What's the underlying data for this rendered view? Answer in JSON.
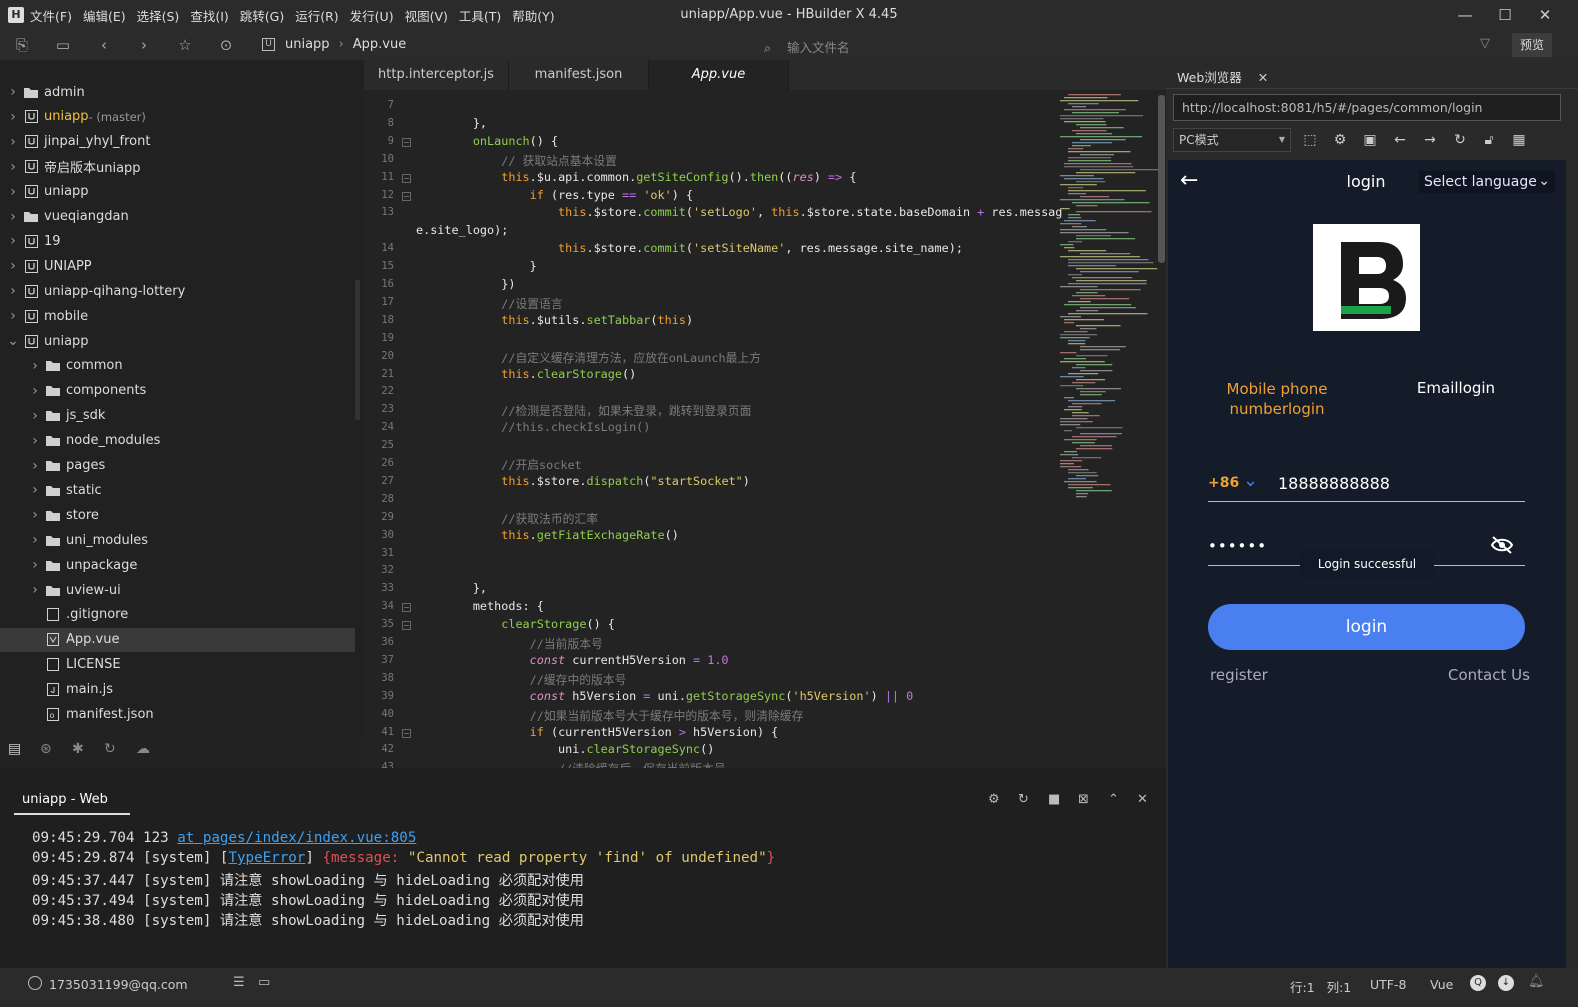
{
  "titlebar": {
    "title": "uniapp/App.vue - HBuilder X 4.45",
    "menu": [
      "文件(F)",
      "编辑(E)",
      "选择(S)",
      "查找(I)",
      "跳转(G)",
      "运行(R)",
      "发行(U)",
      "视图(V)",
      "工具(T)",
      "帮助(Y)"
    ]
  },
  "toolbar": {
    "breadcrumb": [
      "uniapp",
      "App.vue"
    ],
    "search_placeholder": "输入文件名",
    "preview_label": "预览"
  },
  "sidebar": {
    "items": [
      {
        "label": "admin",
        "suffix": "",
        "type": "folder",
        "level": 0,
        "open": false
      },
      {
        "label": "uniapp",
        "suffix": " - (master)",
        "type": "project",
        "level": 0,
        "open": false,
        "accent": true
      },
      {
        "label": "jinpai_yhyl_front",
        "suffix": "",
        "type": "project",
        "level": 0,
        "open": false
      },
      {
        "label": "帝启版本uniapp",
        "suffix": "",
        "type": "project",
        "level": 0,
        "open": false
      },
      {
        "label": "uniapp",
        "suffix": "",
        "type": "project",
        "level": 0,
        "open": false
      },
      {
        "label": "vueqiangdan",
        "suffix": "",
        "type": "folder",
        "level": 0,
        "open": false
      },
      {
        "label": "19",
        "suffix": "",
        "type": "project",
        "level": 0,
        "open": false
      },
      {
        "label": "UNIAPP",
        "suffix": "",
        "type": "project",
        "level": 0,
        "open": false
      },
      {
        "label": "uniapp-qihang-lottery",
        "suffix": "",
        "type": "project",
        "level": 0,
        "open": false
      },
      {
        "label": "mobile",
        "suffix": "",
        "type": "project",
        "level": 0,
        "open": false
      },
      {
        "label": "uniapp",
        "suffix": "",
        "type": "project",
        "level": 0,
        "open": true
      },
      {
        "label": "common",
        "suffix": "",
        "type": "folder",
        "level": 1,
        "open": false
      },
      {
        "label": "components",
        "suffix": "",
        "type": "folder",
        "level": 1,
        "open": false
      },
      {
        "label": "js_sdk",
        "suffix": "",
        "type": "folder",
        "level": 1,
        "open": false
      },
      {
        "label": "node_modules",
        "suffix": "",
        "type": "folder",
        "level": 1,
        "open": false
      },
      {
        "label": "pages",
        "suffix": "",
        "type": "folder",
        "level": 1,
        "open": false
      },
      {
        "label": "static",
        "suffix": "",
        "type": "folder",
        "level": 1,
        "open": false
      },
      {
        "label": "store",
        "suffix": "",
        "type": "folder",
        "level": 1,
        "open": false
      },
      {
        "label": "uni_modules",
        "suffix": "",
        "type": "folder",
        "level": 1,
        "open": false
      },
      {
        "label": "unpackage",
        "suffix": "",
        "type": "folder",
        "level": 1,
        "open": false
      },
      {
        "label": "uview-ui",
        "suffix": "",
        "type": "folder",
        "level": 1,
        "open": false
      },
      {
        "label": ".gitignore",
        "suffix": "",
        "type": "file",
        "level": 1
      },
      {
        "label": "App.vue",
        "suffix": "",
        "type": "vue",
        "level": 1,
        "selected": true
      },
      {
        "label": "LICENSE",
        "suffix": "",
        "type": "file",
        "level": 1
      },
      {
        "label": "main.js",
        "suffix": "",
        "type": "js",
        "level": 1
      },
      {
        "label": "manifest.json",
        "suffix": "",
        "type": "json",
        "level": 1
      }
    ]
  },
  "tabs": [
    "http.interceptor.js",
    "manifest.json",
    "App.vue"
  ],
  "editor": {
    "lines": [
      {
        "n": "7",
        "fold": false,
        "html": ""
      },
      {
        "n": "8",
        "fold": false,
        "html": "        },"
      },
      {
        "n": "9",
        "fold": true,
        "html": "        <span class='fn'>onLaunch</span>() {"
      },
      {
        "n": "10",
        "fold": false,
        "html": "            <span class='cm'>// 获取站点基本设置</span>"
      },
      {
        "n": "11",
        "fold": true,
        "html": "            <span class='kw'>this</span>.$u.api.common.<span class='fn'>getSiteConfig</span>().<span class='fn'>then</span>((<span class='it'>res</span>) <span class='op'>=></span> {"
      },
      {
        "n": "12",
        "fold": true,
        "html": "                <span class='kw'>if</span> (res.type <span class='op'>==</span> <span class='str'>'ok'</span>) {"
      },
      {
        "n": "13",
        "fold": false,
        "html": "                    <span class='kw'>this</span>.$store.<span class='fn'>commit</span>(<span class='str'>'setLogo'</span>, <span class='kw'>this</span>.$store.state.baseDomain <span class='op'>+</span> res.messag"
      },
      {
        "n": "",
        "fold": false,
        "html": "e.site_logo);",
        "wrap": true
      },
      {
        "n": "14",
        "fold": false,
        "html": "                    <span class='kw'>this</span>.$store.<span class='fn'>commit</span>(<span class='str'>'setSiteName'</span>, res.message.site_name);"
      },
      {
        "n": "15",
        "fold": false,
        "html": "                }"
      },
      {
        "n": "16",
        "fold": false,
        "html": "            })"
      },
      {
        "n": "17",
        "fold": false,
        "html": "            <span class='cm'>//设置语言</span>"
      },
      {
        "n": "18",
        "fold": false,
        "html": "            <span class='kw'>this</span>.$utils.<span class='fn'>setTabbar</span>(<span class='kw'>this</span>)"
      },
      {
        "n": "19",
        "fold": false,
        "html": ""
      },
      {
        "n": "20",
        "fold": false,
        "html": "            <span class='cm'>//自定义缓存清理方法，应放在onLaunch最上方</span>"
      },
      {
        "n": "21",
        "fold": false,
        "html": "            <span class='kw'>this</span>.<span class='fn'>clearStorage</span>()"
      },
      {
        "n": "22",
        "fold": false,
        "html": ""
      },
      {
        "n": "23",
        "fold": false,
        "html": "            <span class='cm'>//检测是否登陆，如果未登录，跳转到登录页面</span>"
      },
      {
        "n": "24",
        "fold": false,
        "html": "            <span class='cm'>//this.checkIsLogin()</span>"
      },
      {
        "n": "25",
        "fold": false,
        "html": ""
      },
      {
        "n": "26",
        "fold": false,
        "html": "            <span class='cm'>//开启socket</span>"
      },
      {
        "n": "27",
        "fold": false,
        "html": "            <span class='kw'>this</span>.$store.<span class='fn'>dispatch</span>(<span class='str'>\"startSocket\"</span>)"
      },
      {
        "n": "28",
        "fold": false,
        "html": ""
      },
      {
        "n": "29",
        "fold": false,
        "html": "            <span class='cm'>//获取法币的汇率</span>"
      },
      {
        "n": "30",
        "fold": false,
        "html": "            <span class='kw'>this</span>.<span class='fn'>getFiatExchageRate</span>()"
      },
      {
        "n": "31",
        "fold": false,
        "html": ""
      },
      {
        "n": "32",
        "fold": false,
        "html": ""
      },
      {
        "n": "33",
        "fold": false,
        "html": "        },"
      },
      {
        "n": "34",
        "fold": true,
        "html": "        methods: {"
      },
      {
        "n": "35",
        "fold": true,
        "html": "            <span class='fn'>clearStorage</span>() {"
      },
      {
        "n": "36",
        "fold": false,
        "html": "                <span class='cm'>//当前版本号</span>"
      },
      {
        "n": "37",
        "fold": false,
        "html": "                <span class='it'>const</span> currentH5Version <span class='op'>=</span> <span class='num'>1.0</span>"
      },
      {
        "n": "38",
        "fold": false,
        "html": "                <span class='cm'>//缓存中的版本号</span>"
      },
      {
        "n": "39",
        "fold": false,
        "html": "                <span class='it'>const</span> h5Version <span class='op'>=</span> uni.<span class='fn'>getStorageSync</span>(<span class='str'>'h5Version'</span>) <span class='op'>||</span> <span class='num'>0</span>"
      },
      {
        "n": "40",
        "fold": false,
        "html": "                <span class='cm'>//如果当前版本号大于缓存中的版本号，则清除缓存</span>"
      },
      {
        "n": "41",
        "fold": true,
        "html": "                <span class='kw'>if</span> (currentH5Version <span class='op'>></span> h5Version) {"
      },
      {
        "n": "42",
        "fold": false,
        "html": "                    uni.<span class='fn'>clearStorageSync</span>()"
      },
      {
        "n": "43",
        "fold": false,
        "html": "                    <span class='cm'>//清除缓存后，保存当前版本号</span>"
      }
    ]
  },
  "console": {
    "tab_label": "uniapp - Web",
    "lines": [
      {
        "time": "09:45:29.704",
        "html": "123 <span class='link'>at pages/index/index.vue:805</span>"
      },
      {
        "time": "09:45:29.874",
        "html": "[system] [<span class='link'>TypeError</span>] <span class='red'>{message: </span><span class='str'>\"Cannot read property 'find' of undefined\"</span><span class='red'>}</span>"
      },
      {
        "time": "09:45:37.447",
        "html": "[system] 请注意 showLoading 与 hideLoading 必须配对使用"
      },
      {
        "time": "09:45:37.494",
        "html": "[system] 请注意 showLoading 与 hideLoading 必须配对使用"
      },
      {
        "time": "09:45:38.480",
        "html": "[system] 请注意 showLoading 与 hideLoading 必须配对使用"
      }
    ]
  },
  "browser": {
    "tab_label": "Web浏览器",
    "url": "http://localhost:8081/h5/#/pages/common/login",
    "mode": "PC模式"
  },
  "app": {
    "header_title": "login",
    "language_select": "Select language",
    "tab_phone": "Mobile phone numberlogin",
    "tab_email": "Emaillogin",
    "country_code": "+86",
    "phone_value": "18888888888",
    "password_mask": "••••••",
    "toast": "Login successful",
    "login_button": "login",
    "register_link": "register",
    "contact_link": "Contact Us",
    "accent_color": "#f0a030",
    "button_color": "#4a7fef"
  },
  "statusbar": {
    "user": "1735031199@qq.com",
    "position": "行:1   列:1",
    "encoding": "UTF-8",
    "language": "Vue"
  }
}
